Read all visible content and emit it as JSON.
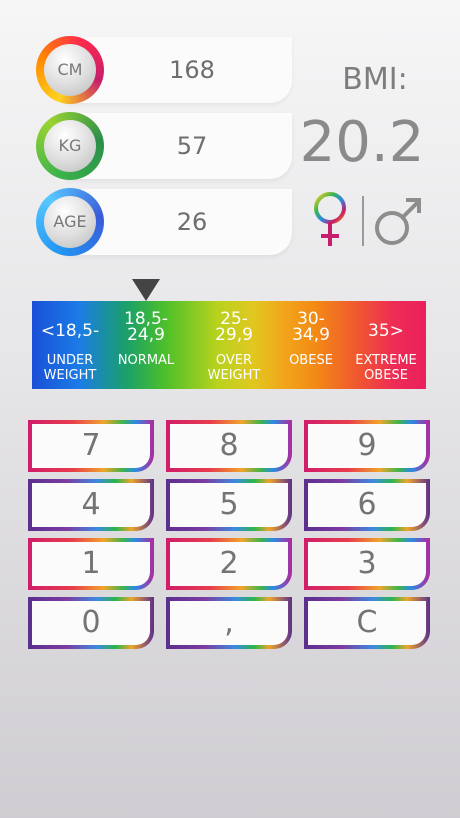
{
  "inputs": [
    {
      "badge": "CM",
      "value": "168"
    },
    {
      "badge": "KG",
      "value": "57"
    },
    {
      "badge": "AGE",
      "value": "26"
    }
  ],
  "bmi": {
    "label": "BMI:",
    "value": "20.2"
  },
  "gender": {
    "female_icon": "female-symbol",
    "male_icon": "male-symbol",
    "female_symbol": "♀",
    "male_symbol": "♂"
  },
  "scale": {
    "categories": [
      {
        "range": "<18,5-",
        "label_lines": [
          "UNDER",
          "WEIGHT"
        ]
      },
      {
        "range_lines": [
          "18,5-",
          "24,9"
        ],
        "label_lines": [
          "NORMAL"
        ]
      },
      {
        "range_lines": [
          "25-",
          "29,9"
        ],
        "label_lines": [
          "OVER",
          "WEIGHT"
        ]
      },
      {
        "range_lines": [
          "30-",
          "34,9"
        ],
        "label_lines": [
          "OBESE"
        ]
      },
      {
        "range": "35>",
        "label_lines": [
          "EXTREME",
          "OBESE"
        ]
      }
    ],
    "colors": [
      "#1a4fd8",
      "#1aa06a",
      "#b8d21e",
      "#f28a15",
      "#e9215c"
    ]
  },
  "keypad": {
    "keys": [
      "7",
      "8",
      "9",
      "4",
      "5",
      "6",
      "1",
      "2",
      "3",
      "0",
      ",",
      "C"
    ]
  }
}
